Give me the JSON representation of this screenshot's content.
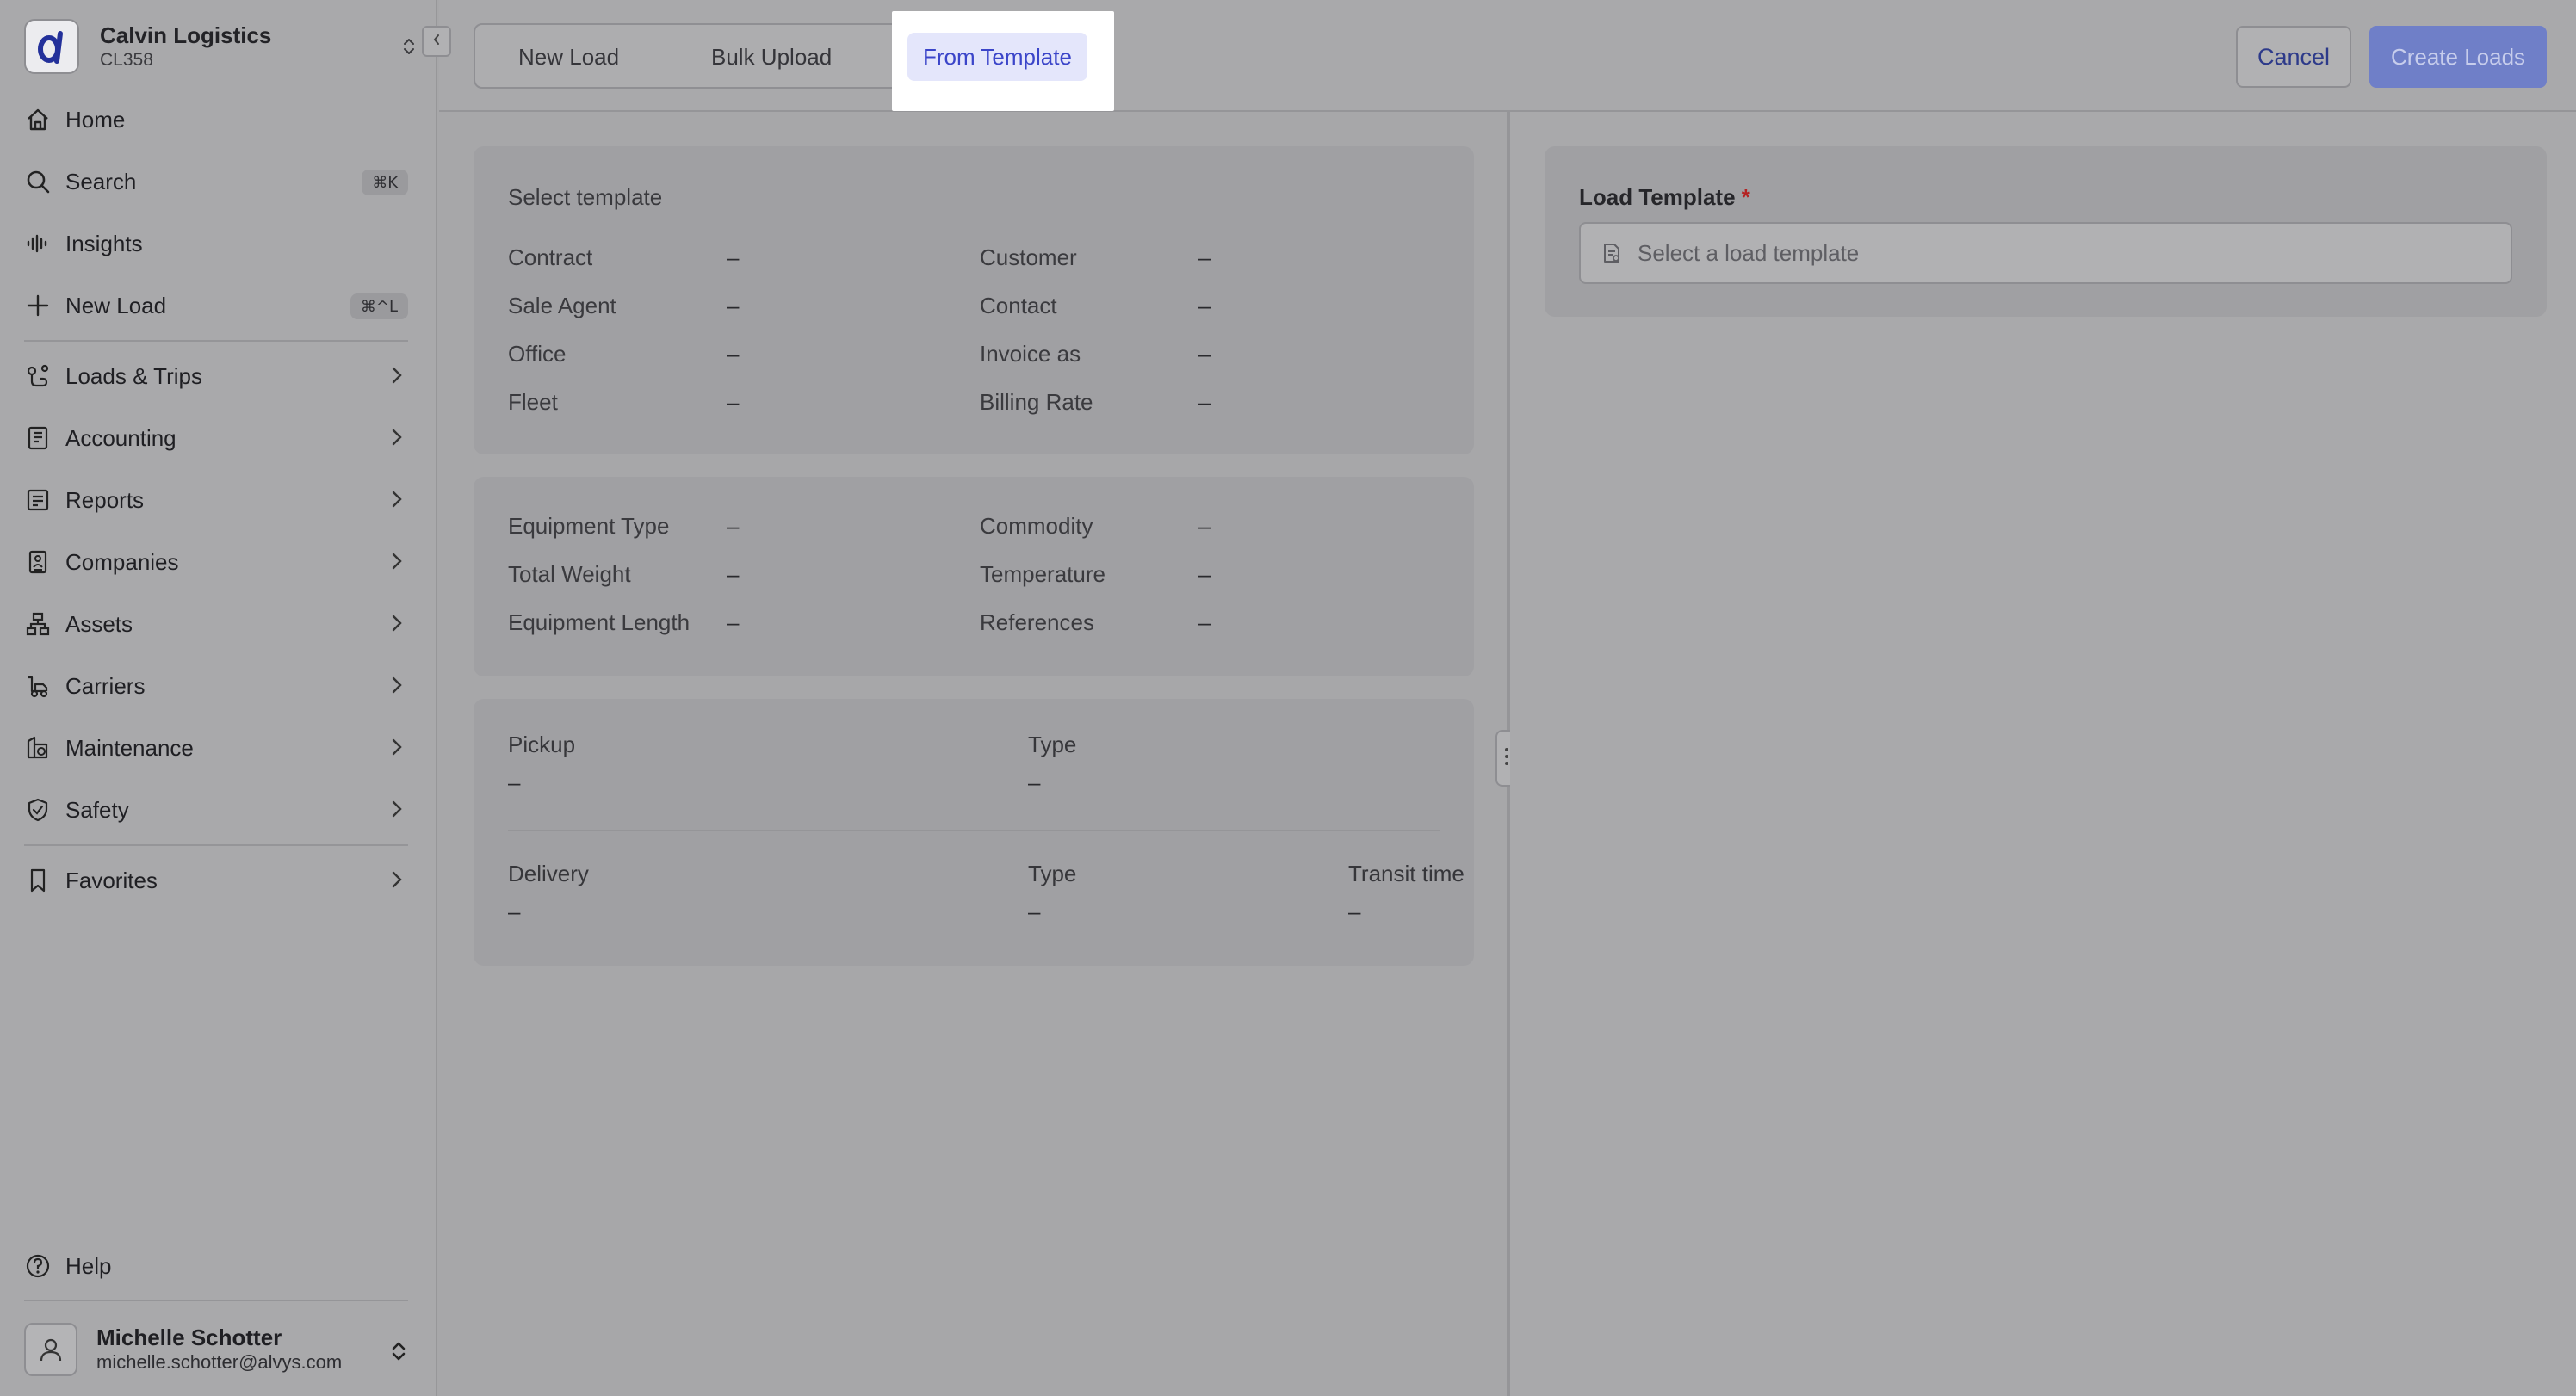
{
  "org": {
    "name": "Calvin Logistics",
    "code": "CL358"
  },
  "nav": {
    "home": "Home",
    "search": "Search",
    "search_kbd": "⌘K",
    "insights": "Insights",
    "new_load": "New Load",
    "new_load_kbd": "⌘^L",
    "loads_trips": "Loads & Trips",
    "accounting": "Accounting",
    "reports": "Reports",
    "companies": "Companies",
    "assets": "Assets",
    "carriers": "Carriers",
    "maintenance": "Maintenance",
    "safety": "Safety",
    "favorites": "Favorites",
    "help": "Help"
  },
  "user": {
    "name": "Michelle Schotter",
    "email": "michelle.schotter@alvys.com"
  },
  "header": {
    "tabs": [
      "New Load",
      "Bulk Upload",
      "From Template"
    ],
    "active_tab": "From Template",
    "cancel_label": "Cancel",
    "create_label": "Create Loads"
  },
  "summary": {
    "title": "Select template",
    "contract": {
      "label": "Contract",
      "value": "–"
    },
    "customer": {
      "label": "Customer",
      "value": "–"
    },
    "sale_agent": {
      "label": "Sale Agent",
      "value": "–"
    },
    "contact": {
      "label": "Contact",
      "value": "–"
    },
    "office": {
      "label": "Office",
      "value": "–"
    },
    "invoice_as": {
      "label": "Invoice as",
      "value": "–"
    },
    "fleet": {
      "label": "Fleet",
      "value": "–"
    },
    "billing_rate": {
      "label": "Billing Rate",
      "value": "–"
    }
  },
  "equipment": {
    "equipment_type": {
      "label": "Equipment Type",
      "value": "–"
    },
    "commodity": {
      "label": "Commodity",
      "value": "–"
    },
    "total_weight": {
      "label": "Total Weight",
      "value": "–"
    },
    "temperature": {
      "label": "Temperature",
      "value": "–"
    },
    "equipment_length": {
      "label": "Equipment Length",
      "value": "–"
    },
    "references": {
      "label": "References",
      "value": "–"
    }
  },
  "stops": {
    "pickup": {
      "label": "Pickup",
      "value": "–",
      "type_label": "Type",
      "type_value": "–"
    },
    "delivery": {
      "label": "Delivery",
      "value": "–",
      "type_label": "Type",
      "type_value": "–",
      "transit_label": "Transit time",
      "transit_value": "–"
    }
  },
  "template": {
    "label": "Load Template",
    "required_mark": "*",
    "placeholder": "Select a load template"
  },
  "colors": {
    "accent": "#3b45c9",
    "active_tab_bg": "#e4e6fb",
    "primary_button": "#6f7fc8",
    "required": "#b42323"
  }
}
